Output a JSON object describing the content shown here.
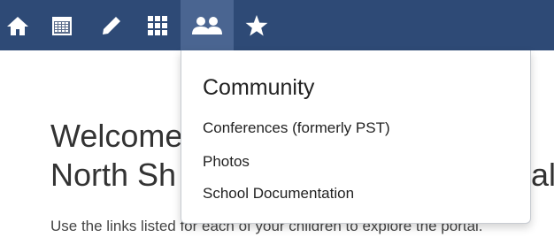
{
  "navbar": {
    "icons": [
      "home-icon",
      "calendar-icon",
      "pencil-icon",
      "grid-icon",
      "community-icon",
      "star-icon"
    ],
    "active": "community-icon",
    "background": "#2e4a76",
    "active_background": "#4a6591"
  },
  "dropdown": {
    "heading": "Community",
    "items": [
      {
        "label": "Conferences (formerly PST)"
      },
      {
        "label": "Photos"
      },
      {
        "label": "School Documentation"
      }
    ]
  },
  "main": {
    "welcome_line1": "Welcome",
    "welcome_line2": "North Sh",
    "welcome_line2_tail": "al",
    "intro": "Use the links listed for each of your children to explore the portal."
  }
}
